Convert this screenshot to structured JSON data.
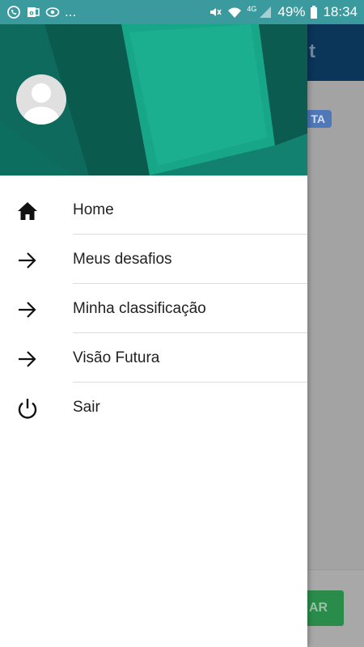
{
  "status_bar": {
    "overflow": "...",
    "network": "4G",
    "battery": "49%",
    "time": "18:34"
  },
  "background_app": {
    "toolbar_title_fragment": "t",
    "badge_fragment": "TA",
    "action_button_fragment": "AR"
  },
  "drawer": {
    "items": [
      {
        "label": "Home",
        "icon": "home-icon"
      },
      {
        "label": "Meus desafios",
        "icon": "arrow-right-icon"
      },
      {
        "label": "Minha classificação",
        "icon": "arrow-right-icon"
      },
      {
        "label": "Visão Futura",
        "icon": "arrow-right-icon"
      },
      {
        "label": "Sair",
        "icon": "power-icon"
      }
    ]
  },
  "colors": {
    "status_bar": "#3b9a9e",
    "header_teal": "#0f5e54",
    "toolbar": "#0b3559",
    "action_green": "#2a8c4a"
  }
}
